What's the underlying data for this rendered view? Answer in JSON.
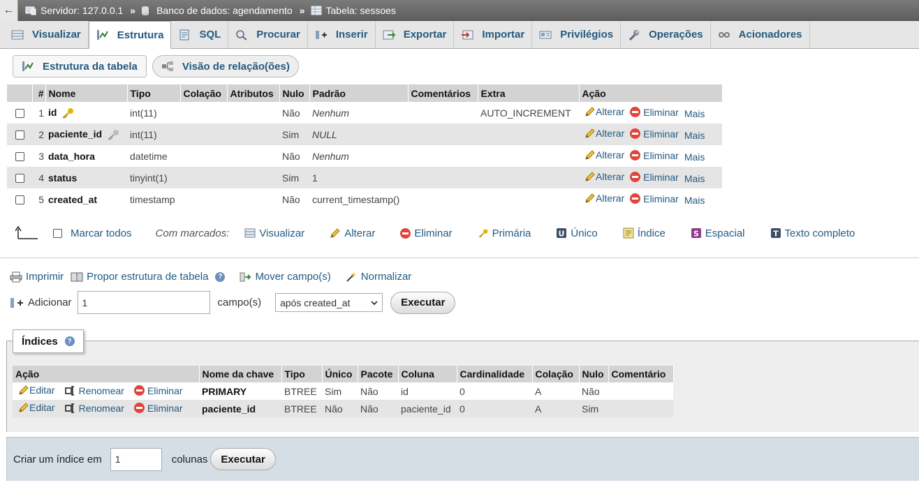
{
  "breadcrumb": {
    "back": "←",
    "server": "Servidor: 127.0.0.1",
    "database": "Banco de dados: agendamento",
    "table": "Tabela: sessoes",
    "separator": "»"
  },
  "tabs": [
    {
      "label": "Visualizar",
      "icon": "table-browse-icon",
      "active": false
    },
    {
      "label": "Estrutura",
      "icon": "structure-icon",
      "active": true
    },
    {
      "label": "SQL",
      "icon": "sql-icon",
      "active": false
    },
    {
      "label": "Procurar",
      "icon": "search-icon",
      "active": false
    },
    {
      "label": "Inserir",
      "icon": "insert-icon",
      "active": false
    },
    {
      "label": "Exportar",
      "icon": "export-icon",
      "active": false
    },
    {
      "label": "Importar",
      "icon": "import-icon",
      "active": false
    },
    {
      "label": "Privilégios",
      "icon": "privileges-icon",
      "active": false
    },
    {
      "label": "Operações",
      "icon": "wrench-icon",
      "active": false
    },
    {
      "label": "Acionadores",
      "icon": "triggers-icon",
      "active": false
    }
  ],
  "subnav": {
    "table_structure": "Estrutura da tabela",
    "relation_view": "Visão de relação(ões)"
  },
  "structure": {
    "headers": [
      "#",
      "Nome",
      "Tipo",
      "Colação",
      "Atributos",
      "Nulo",
      "Padrão",
      "Comentários",
      "Extra",
      "Ação"
    ],
    "rows": [
      {
        "num": "1",
        "name": "id",
        "type": "int(11)",
        "collation": "",
        "attributes": "",
        "null": "Não",
        "default": "Nenhum",
        "comments": "",
        "extra": "AUTO_INCREMENT",
        "key": "primary"
      },
      {
        "num": "2",
        "name": "paciente_id",
        "type": "int(11)",
        "collation": "",
        "attributes": "",
        "null": "Sim",
        "default": "NULL",
        "comments": "",
        "extra": "",
        "key": "index"
      },
      {
        "num": "3",
        "name": "data_hora",
        "type": "datetime",
        "collation": "",
        "attributes": "",
        "null": "Não",
        "default": "Nenhum",
        "comments": "",
        "extra": "",
        "key": ""
      },
      {
        "num": "4",
        "name": "status",
        "type": "tinyint(1)",
        "collation": "",
        "attributes": "",
        "null": "Sim",
        "default": "1",
        "comments": "",
        "extra": "",
        "key": ""
      },
      {
        "num": "5",
        "name": "created_at",
        "type": "timestamp",
        "collation": "",
        "attributes": "",
        "null": "Não",
        "default": "current_timestamp()",
        "comments": "",
        "extra": "",
        "key": ""
      }
    ],
    "actions": {
      "change": "Alterar",
      "drop": "Eliminar",
      "more": "Mais"
    }
  },
  "with_selected": {
    "check_all": "Marcar todos",
    "label": "Com marcados:",
    "items": [
      {
        "label": "Visualizar",
        "icon": "table-browse-icon"
      },
      {
        "label": "Alterar",
        "icon": "pencil-icon"
      },
      {
        "label": "Eliminar",
        "icon": "drop-icon"
      },
      {
        "label": "Primária",
        "icon": "primary-key-icon"
      },
      {
        "label": "Único",
        "icon": "unique-icon"
      },
      {
        "label": "Índice",
        "icon": "index-icon"
      },
      {
        "label": "Espacial",
        "icon": "spatial-icon"
      },
      {
        "label": "Texto completo",
        "icon": "fulltext-icon"
      }
    ]
  },
  "tools": {
    "print": "Imprimir",
    "propose": "Propor estrutura de tabela",
    "move": "Mover campo(s)",
    "normalize": "Normalizar"
  },
  "add_column": {
    "label": "Adicionar",
    "count": "1",
    "fields_label": "campo(s)",
    "position": "após created_at",
    "go": "Executar"
  },
  "indexes": {
    "title": "Índices",
    "headers": [
      "Ação",
      "Nome da chave",
      "Tipo",
      "Único",
      "Pacote",
      "Coluna",
      "Cardinalidade",
      "Colação",
      "Nulo",
      "Comentário"
    ],
    "actions": {
      "edit": "Editar",
      "rename": "Renomear",
      "drop": "Eliminar"
    },
    "rows": [
      {
        "key_name": "PRIMARY",
        "type": "BTREE",
        "unique": "Sim",
        "packed": "Não",
        "column": "id",
        "cardinality": "0",
        "collation": "A",
        "null": "Não",
        "comment": ""
      },
      {
        "key_name": "paciente_id",
        "type": "BTREE",
        "unique": "Não",
        "packed": "Não",
        "column": "paciente_id",
        "cardinality": "0",
        "collation": "A",
        "null": "Sim",
        "comment": ""
      }
    ]
  },
  "create_index": {
    "label": "Criar um índice em",
    "count": "1",
    "columns_label": "colunas",
    "go": "Executar"
  },
  "colors": {
    "link": "#235a81",
    "header_bg": "#d3d3d3",
    "drop": "#e0453a"
  }
}
